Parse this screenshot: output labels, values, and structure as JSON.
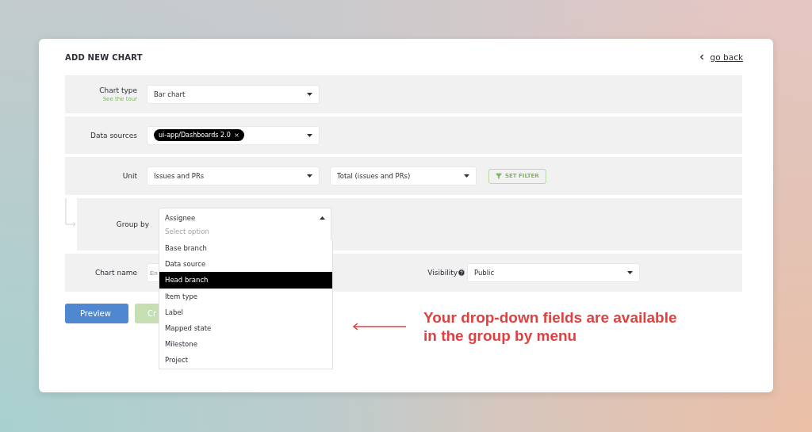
{
  "header": {
    "title": "ADD NEW CHART",
    "back_link": "go back"
  },
  "chart_type": {
    "label": "Chart type",
    "tour_link": "See the tour",
    "value": "Bar chart"
  },
  "data_sources": {
    "label": "Data sources",
    "tags": [
      {
        "label": "ui-app/Dashboards 2.0"
      }
    ]
  },
  "unit": {
    "label": "Unit",
    "value": "Issues and PRs",
    "aggregate": "Total (issues and PRs)",
    "filter_button": "SET FILTER"
  },
  "group_by": {
    "label": "Group by",
    "value": "Assignee",
    "search_placeholder": "Select option",
    "expanded": true,
    "options": [
      {
        "label": "Base branch",
        "selected": false
      },
      {
        "label": "Data source",
        "selected": false
      },
      {
        "label": "Head branch",
        "selected": true
      },
      {
        "label": "Item type",
        "selected": false
      },
      {
        "label": "Label",
        "selected": false
      },
      {
        "label": "Mapped state",
        "selected": false
      },
      {
        "label": "Milestone",
        "selected": false
      },
      {
        "label": "Project",
        "selected": false
      }
    ]
  },
  "chart_name": {
    "label": "Chart name",
    "placeholder": "En"
  },
  "visibility": {
    "label": "Visibility",
    "value": "Public"
  },
  "buttons": [
    {
      "label": "Preview",
      "kind": "primary"
    },
    {
      "label": "Cr",
      "kind": "create"
    }
  ],
  "annotation": "Your drop-down fields are available in the group by menu"
}
